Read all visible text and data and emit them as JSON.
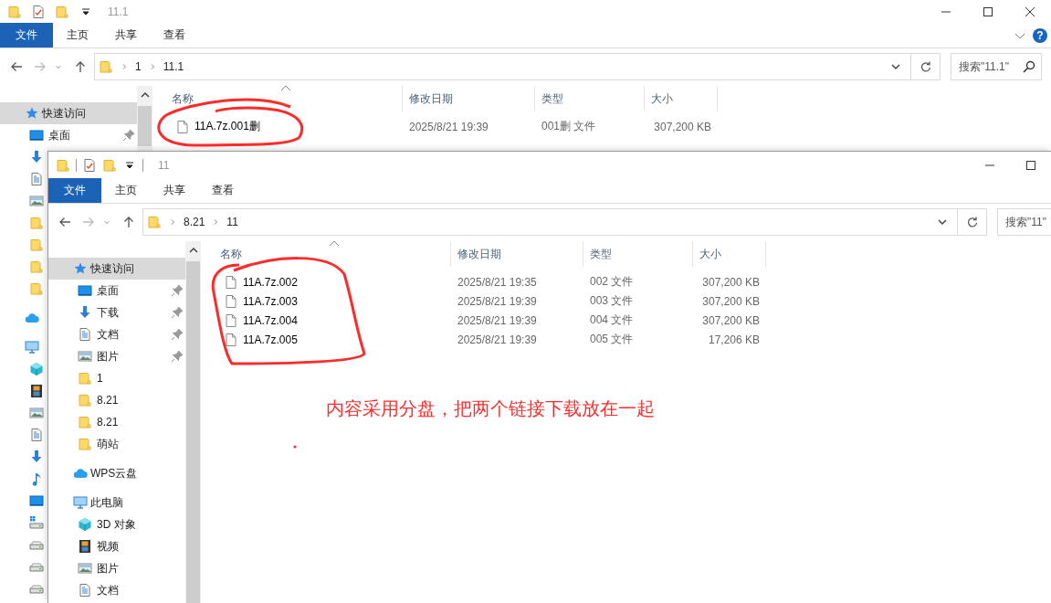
{
  "back_window": {
    "title": "11.1",
    "ribbon_tabs": [
      {
        "kind": "file",
        "label": "文件"
      },
      {
        "kind": "tab",
        "label": "主页"
      },
      {
        "kind": "tab",
        "label": "共享"
      },
      {
        "kind": "tab",
        "label": "查看"
      }
    ],
    "help_button": "?",
    "address": {
      "crumbs": [
        "1",
        "11.1"
      ]
    },
    "search": {
      "placeholder": "搜索\"11.1\""
    },
    "sidebar": [
      {
        "kind": "quick",
        "label": "快速访问",
        "selected": true,
        "pinned": false,
        "children": [
          {
            "kind": "desktop",
            "label": "桌面",
            "selected": false,
            "pinned": true
          },
          {
            "kind": "download"
          },
          {
            "kind": "document"
          },
          {
            "kind": "picture"
          },
          {
            "kind": "folder"
          },
          {
            "kind": "folder"
          },
          {
            "kind": "folder"
          },
          {
            "kind": "folder"
          }
        ]
      },
      {
        "kind": "cloud"
      },
      {
        "kind": "pc",
        "children": [
          {
            "kind": "cube"
          },
          {
            "kind": "video"
          },
          {
            "kind": "picture"
          },
          {
            "kind": "document"
          },
          {
            "kind": "download"
          },
          {
            "kind": "music"
          },
          {
            "kind": "desktop"
          },
          {
            "kind": "sysdrive"
          },
          {
            "kind": "drive"
          },
          {
            "kind": "drive"
          },
          {
            "kind": "drive"
          }
        ]
      }
    ],
    "columns": [
      "名称",
      "修改日期",
      "类型",
      "大小"
    ],
    "files": [
      {
        "name": "11A.7z.001删",
        "modified": "2025/8/21 19:39",
        "type": "001删 文件",
        "size": "307,200 KB"
      }
    ]
  },
  "front_window": {
    "title": "11",
    "ribbon_tabs": [
      {
        "kind": "file",
        "label": "文件"
      },
      {
        "kind": "tab",
        "label": "主页"
      },
      {
        "kind": "tab",
        "label": "共享"
      },
      {
        "kind": "tab",
        "label": "查看"
      }
    ],
    "address": {
      "crumbs": [
        "8.21",
        "11"
      ]
    },
    "search": {
      "placeholder": "搜索\"11\""
    },
    "sidebar": [
      {
        "kind": "quick",
        "label": "快速访问",
        "selected": true,
        "pinned": false,
        "children": [
          {
            "kind": "desktop",
            "label": "桌面",
            "selected": false,
            "pinned": true
          },
          {
            "kind": "download",
            "label": "下载",
            "selected": false,
            "pinned": true
          },
          {
            "kind": "document",
            "label": "文档",
            "selected": false,
            "pinned": true
          },
          {
            "kind": "picture",
            "label": "图片",
            "selected": false,
            "pinned": true
          },
          {
            "kind": "folder",
            "label": "1",
            "selected": false,
            "pinned": false
          },
          {
            "kind": "folder",
            "label": "8.21",
            "selected": false,
            "pinned": false
          },
          {
            "kind": "folder",
            "label": "8.21",
            "selected": false,
            "pinned": false
          },
          {
            "kind": "folder",
            "label": "萌站",
            "selected": false,
            "pinned": false
          }
        ]
      },
      {
        "kind": "cloud",
        "label": "WPS云盘",
        "selected": false,
        "pinned": false
      },
      {
        "kind": "pc",
        "label": "此电脑",
        "selected": false,
        "pinned": false,
        "children": [
          {
            "kind": "cube",
            "label": "3D 对象",
            "selected": false,
            "pinned": false
          },
          {
            "kind": "video",
            "label": "视频",
            "selected": false,
            "pinned": false
          },
          {
            "kind": "picture",
            "label": "图片",
            "selected": false,
            "pinned": false
          },
          {
            "kind": "document",
            "label": "文档",
            "selected": false,
            "pinned": false
          }
        ]
      }
    ],
    "columns": [
      "名称",
      "修改日期",
      "类型",
      "大小"
    ],
    "files": [
      {
        "name": "11A.7z.002",
        "modified": "2025/8/21 19:35",
        "type": "002 文件",
        "size": "307,200 KB"
      },
      {
        "name": "11A.7z.003",
        "modified": "2025/8/21 19:39",
        "type": "003 文件",
        "size": "307,200 KB"
      },
      {
        "name": "11A.7z.004",
        "modified": "2025/8/21 19:39",
        "type": "004 文件",
        "size": "307,200 KB"
      },
      {
        "name": "11A.7z.005",
        "modified": "2025/8/21 19:39",
        "type": "005 文件",
        "size": "17,206 KB"
      }
    ]
  },
  "annotations": [
    {
      "kind": "circle"
    },
    {
      "kind": "circle"
    },
    {
      "kind": "note",
      "text": "内容采用分盘，把两个链接下载放在一起"
    },
    {
      "kind": "dot"
    }
  ]
}
